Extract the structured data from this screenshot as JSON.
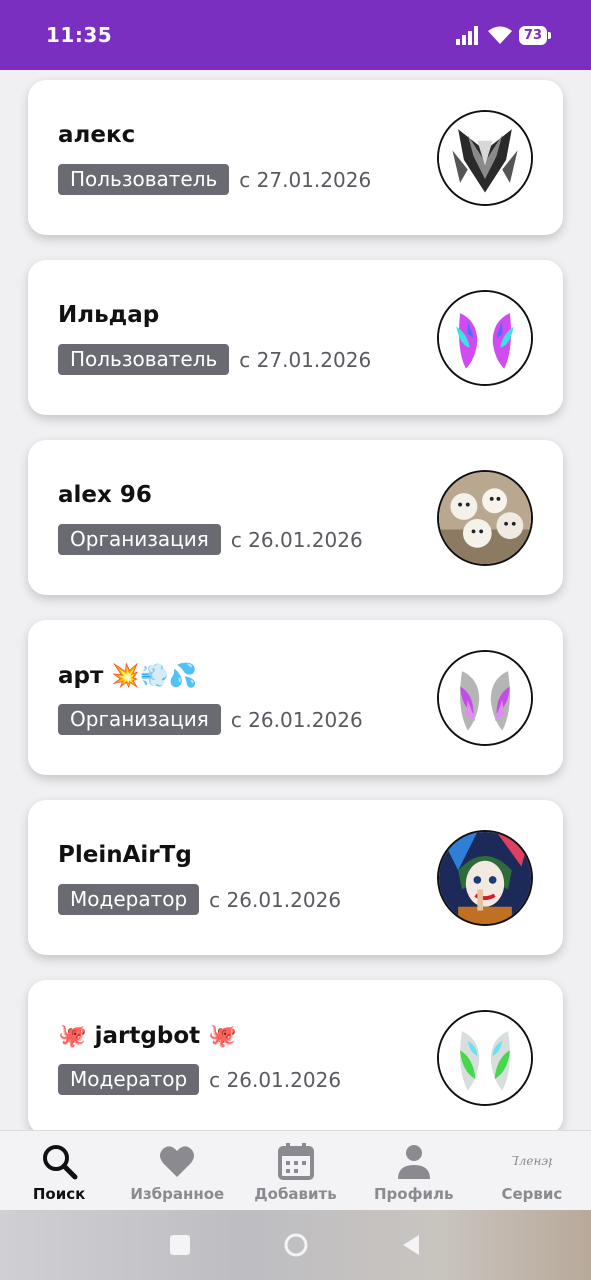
{
  "status": {
    "time": "11:35",
    "battery": "73"
  },
  "users": [
    {
      "name": "алекс",
      "role": "Пользователь",
      "since": "с 27.01.2026",
      "avatar": "dark-abstract-avatar"
    },
    {
      "name": "Ильдар",
      "role": "Пользователь",
      "since": "с 27.01.2026",
      "avatar": "neon-wings-avatar"
    },
    {
      "name": "alex 96",
      "role": "Организация",
      "since": "с 26.01.2026",
      "avatar": "dogs-meme-avatar"
    },
    {
      "name": "арт 💥💨💦",
      "role": "Организация",
      "since": "с 26.01.2026",
      "avatar": "purple-wings-avatar"
    },
    {
      "name": "PleinAirTg",
      "role": "Модератор",
      "since": "с 26.01.2026",
      "avatar": "joker-painting-avatar"
    },
    {
      "name": "🐙 jartgbot 🐙",
      "role": "Модератор",
      "since": "с 26.01.2026",
      "avatar": "green-wings-avatar"
    }
  ],
  "nav": {
    "search": "Поиск",
    "favorites": "Избранное",
    "add": "Добавить",
    "profile": "Профиль",
    "service": "Сервис",
    "service_logo_text": "Пленэр"
  },
  "colors": {
    "accent": "#7b2fc0",
    "badge": "#6a6a72",
    "card": "#ffffff"
  }
}
